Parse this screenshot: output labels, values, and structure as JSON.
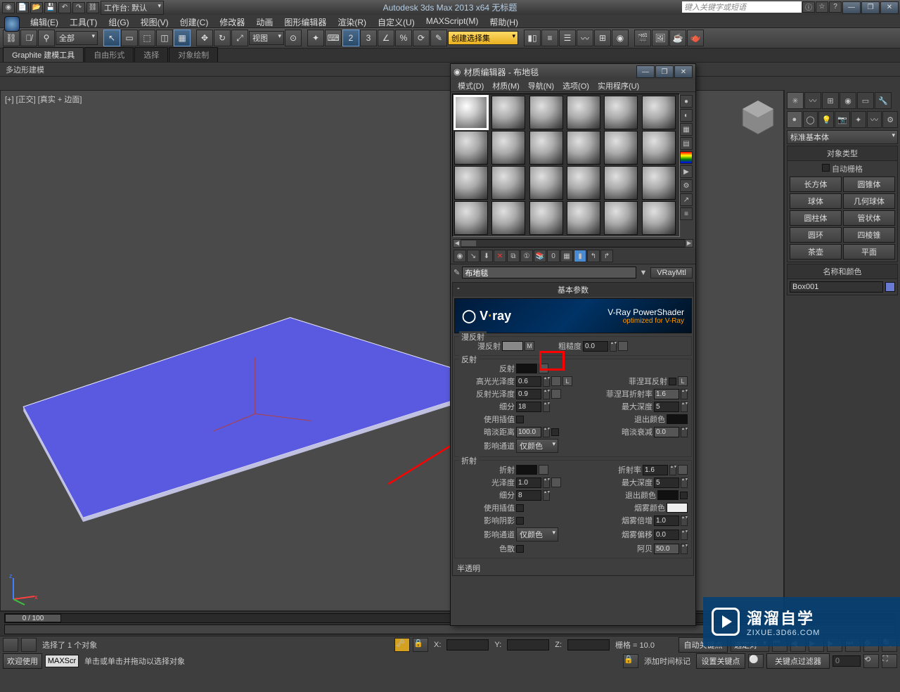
{
  "title": "Autodesk 3ds Max  2013 x64     无标题",
  "search_placeholder": "键入关键字或短语",
  "workspace_label": "工作台: 默认",
  "menus": [
    "编辑(E)",
    "工具(T)",
    "组(G)",
    "视图(V)",
    "创建(C)",
    "修改器",
    "动画",
    "图形编辑器",
    "渲染(R)",
    "自定义(U)",
    "MAXScript(M)",
    "帮助(H)"
  ],
  "toolbar": {
    "scope": "全部",
    "viewmode": "视图",
    "selectset": "创建选择集"
  },
  "ribbon_tabs": [
    "Graphite 建模工具",
    "自由形式",
    "选择",
    "对象绘制"
  ],
  "ribbon_sub": "多边形建模",
  "viewport_label": "[+] [正交] [真实 + 边面]",
  "right_panel": {
    "category": "标准基本体",
    "sec_obj_type": "对象类型",
    "auto_grid": "自动栅格",
    "primitives": [
      [
        "长方体",
        "圆锥体"
      ],
      [
        "球体",
        "几何球体"
      ],
      [
        "圆柱体",
        "管状体"
      ],
      [
        "圆环",
        "四棱锥"
      ],
      [
        "茶壶",
        "平面"
      ]
    ],
    "sec_name_color": "名称和颜色",
    "object_name": "Box001"
  },
  "timeline": {
    "range": "0 / 100"
  },
  "status": {
    "welcome": "欢迎使用",
    "maxscr": "MAXScr",
    "sel": "选择了 1 个对象",
    "hint": "单击或单击并拖动以选择对象",
    "x": "X:",
    "y": "Y:",
    "z": "Z:",
    "grid_label": "栅格 = 10.0",
    "autokey": "自动关键点",
    "setkey": "设置关键点",
    "keyfilter": "关键点过滤器",
    "selected": "选定对",
    "addmarker": "添加时间标记"
  },
  "mat_editor": {
    "title": "材质编辑器 - 布地毯",
    "menus": [
      "模式(D)",
      "材质(M)",
      "导航(N)",
      "选项(O)",
      "实用程序(U)"
    ],
    "name": "布地毯",
    "type": "VRayMtl",
    "rollout_basic": "基本参数",
    "vray_title": "V-Ray PowerShader",
    "vray_sub": "optimized for V-Ray",
    "grp_diffuse": "漫反射",
    "diffuse": "漫反射",
    "map_m": "M",
    "roughness": "粗糙度",
    "roughness_v": "0.0",
    "grp_reflect": "反射",
    "reflect": "反射",
    "hilight": "高光光泽度",
    "hilight_v": "0.6",
    "lock": "L",
    "rglossy": "反射光泽度",
    "rglossy_v": "0.9",
    "fresnel": "菲涅耳反射",
    "fresnel_ior": "菲涅耳折射率",
    "fresnel_ior_v": "1.6",
    "subdiv": "细分",
    "subdiv_v": "18",
    "maxdepth": "最大深度",
    "maxdepth_v": "5",
    "interp": "使用插值",
    "exitcolor": "退出颜色",
    "dimdist": "暗淡距离",
    "dimdist_v": "100.0",
    "dimfall": "暗淡衰减",
    "dimfall_v": "0.0",
    "affect": "影响通道",
    "affect_v": "仅颜色",
    "grp_refract": "折射",
    "refract": "折射",
    "ior": "折射率",
    "ior_v": "1.6",
    "glossy": "光泽度",
    "glossy_v": "1.0",
    "affect_shadow": "影响阴影",
    "fog_color": "烟雾颜色",
    "fog_mult": "烟雾倍增",
    "fog_mult_v": "1.0",
    "fog_bias": "烟雾偏移",
    "fog_bias_v": "0.0",
    "dispersion": "色散",
    "abbe": "阿贝",
    "abbe_v": "50.0",
    "translucent": "半透明"
  },
  "watermark": {
    "big": "溜溜自学",
    "small": "ZIXUE.3D66.COM"
  }
}
